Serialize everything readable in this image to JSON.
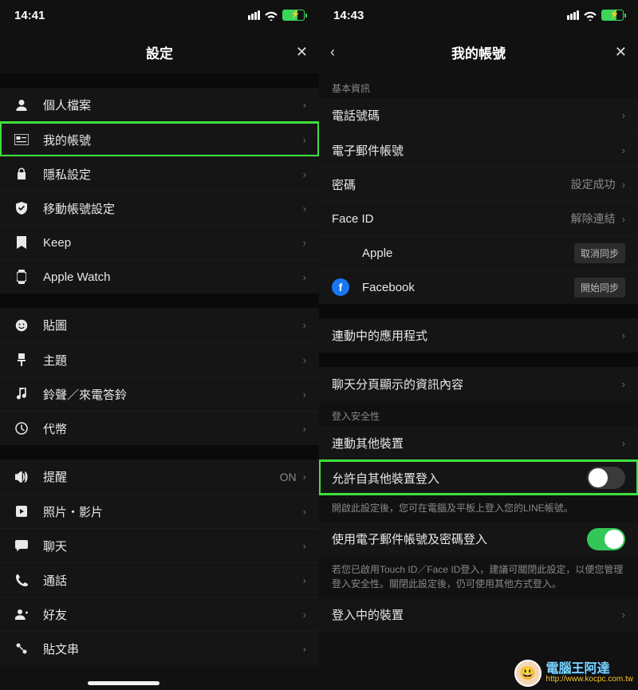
{
  "left": {
    "time": "14:41",
    "title": "設定",
    "group1": [
      {
        "icon": "person",
        "label": "個人檔案"
      },
      {
        "icon": "idcard",
        "label": "我的帳號",
        "highlight": true
      },
      {
        "icon": "lock",
        "label": "隱私設定"
      },
      {
        "icon": "shield",
        "label": "移動帳號設定"
      },
      {
        "icon": "bookmark",
        "label": "Keep"
      },
      {
        "icon": "watch",
        "label": "Apple Watch"
      }
    ],
    "group2": [
      {
        "icon": "smile",
        "label": "貼圖"
      },
      {
        "icon": "brush",
        "label": "主題"
      },
      {
        "icon": "music",
        "label": "鈴聲／來電答鈴"
      },
      {
        "icon": "clock",
        "label": "代幣"
      }
    ],
    "group3": [
      {
        "icon": "speaker",
        "label": "提醒",
        "value": "ON"
      },
      {
        "icon": "play",
        "label": "照片・影片"
      },
      {
        "icon": "chat",
        "label": "聊天"
      },
      {
        "icon": "phone",
        "label": "通話"
      },
      {
        "icon": "friend",
        "label": "好友"
      },
      {
        "icon": "timeline",
        "label": "貼文串"
      }
    ]
  },
  "right": {
    "time": "14:43",
    "title": "我的帳號",
    "section_basic": "基本資訊",
    "basic_rows": [
      {
        "label": "電話號碼",
        "chev": true
      },
      {
        "label": "電子郵件帳號",
        "chev": true
      },
      {
        "label": "密碼",
        "value": "設定成功",
        "chev": true
      },
      {
        "label": "Face ID",
        "value": "解除連結",
        "chev": true
      }
    ],
    "brand_rows": [
      {
        "brand": "apple",
        "label": "Apple",
        "pill": "取消同步"
      },
      {
        "brand": "fb",
        "label": "Facebook",
        "pill": "開始同步"
      }
    ],
    "linked_apps": "連動中的應用程式",
    "chat_info": "聊天分頁顯示的資訊內容",
    "section_security": "登入安全性",
    "link_other": "連動其他裝置",
    "allow_other_label": "允許自其他裝置登入",
    "allow_other_desc": "開啟此設定後，您可在電腦及平板上登入您的LINE帳號。",
    "email_login_label": "使用電子郵件帳號及密碼登入",
    "email_login_desc": "若您已啟用Touch ID／Face ID登入，建議可關閉此設定，以便您管理登入安全性。關閉此設定後，仍可使用其他方式登入。",
    "logged_in_devices": "登入中的裝置"
  },
  "watermark": {
    "t1": "電腦王阿達",
    "t2": "http://www.kocpc.com.tw"
  }
}
